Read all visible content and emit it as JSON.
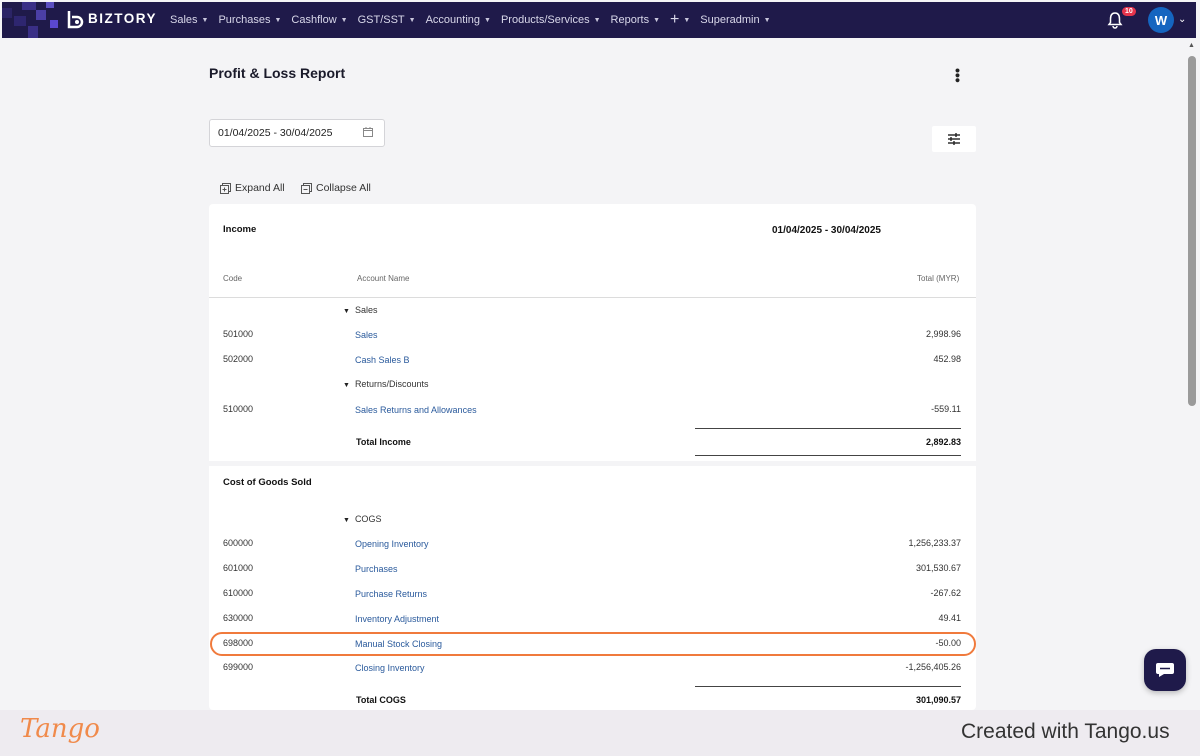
{
  "topbar": {
    "brand": "BIZTORY",
    "nav": [
      "Sales",
      "Purchases",
      "Cashflow",
      "GST/SST",
      "Accounting",
      "Products/Services",
      "Reports",
      "+",
      "Superadmin"
    ],
    "notification_count": "10",
    "avatar_initial": "W",
    "accent": "#1f1a4a"
  },
  "page": {
    "title": "Profit & Loss Report",
    "date_range_value": "01/04/2025 - 30/04/2025",
    "expand_all": "Expand All",
    "collapse_all": "Collapse All"
  },
  "report": {
    "income": {
      "title": "Income",
      "period": "01/04/2025 - 30/04/2025",
      "col_code": "Code",
      "col_account": "Account Name",
      "col_total": "Total (MYR)",
      "groups": [
        {
          "name": "Sales",
          "rows": [
            {
              "code": "501000",
              "account": "Sales",
              "amount": "2,998.96"
            },
            {
              "code": "502000",
              "account": "Cash Sales B",
              "amount": "452.98"
            }
          ]
        },
        {
          "name": "Returns/Discounts",
          "rows": [
            {
              "code": "510000",
              "account": "Sales Returns and Allowances",
              "amount": "-559.11"
            }
          ]
        }
      ],
      "total_label": "Total Income",
      "total_amount": "2,892.83"
    },
    "cogs": {
      "title": "Cost of Goods Sold",
      "group": "COGS",
      "rows": [
        {
          "code": "600000",
          "account": "Opening Inventory",
          "amount": "1,256,233.37"
        },
        {
          "code": "601000",
          "account": "Purchases",
          "amount": "301,530.67"
        },
        {
          "code": "610000",
          "account": "Purchase Returns",
          "amount": "-267.62"
        },
        {
          "code": "630000",
          "account": "Inventory Adjustment",
          "amount": "49.41"
        },
        {
          "code": "698000",
          "account": "Manual Stock Closing",
          "amount": "-50.00"
        },
        {
          "code": "699000",
          "account": "Closing Inventory",
          "amount": "-1,256,405.26"
        }
      ],
      "total_label": "Total COGS",
      "total_amount": "301,090.57"
    }
  },
  "footer": {
    "logo": "Tango",
    "text": "Created with Tango.us",
    "highlight_color": "#f07a3c"
  }
}
